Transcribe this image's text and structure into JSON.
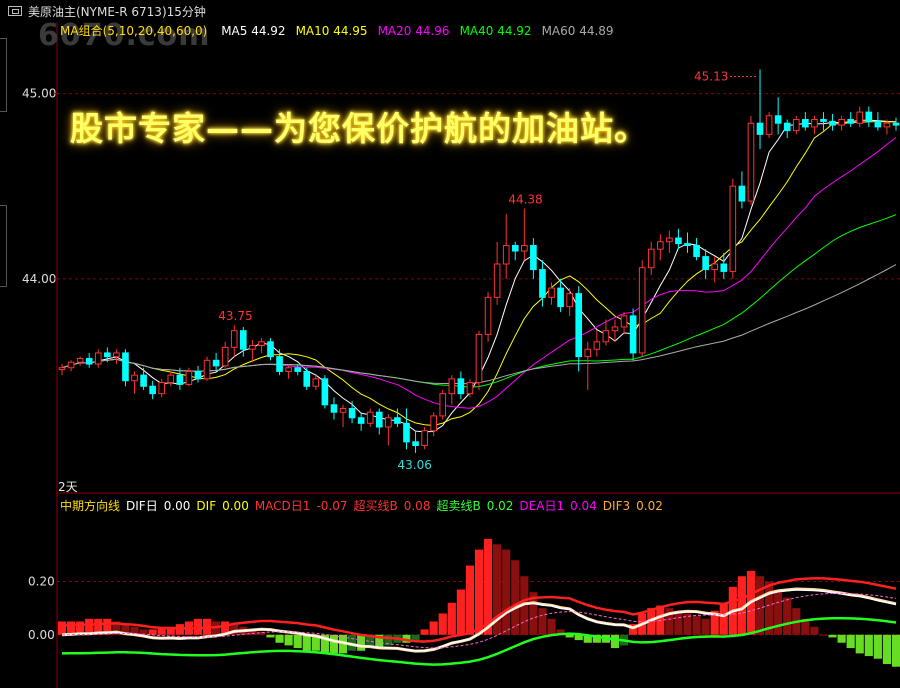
{
  "window": {
    "title": "美原油主(NYME-R 6713)15分钟",
    "watermark": "6070.com"
  },
  "slogan": "股市专家——为您保价护航的加油站。",
  "ma_bar": {
    "group_label": "MA组合(5,10,20,40,60,0)",
    "items": [
      {
        "label": "MA5 44.92",
        "color": "#ffffff"
      },
      {
        "label": "MA10 44.95",
        "color": "#ffff00"
      },
      {
        "label": "MA20 44.96",
        "color": "#ff00ff"
      },
      {
        "label": "MA40 44.92",
        "color": "#00ff00"
      },
      {
        "label": "MA60 44.89",
        "color": "#aaaaaa"
      }
    ]
  },
  "period_label": "2天",
  "macd_bar": {
    "items": [
      {
        "label": "中期方向线",
        "color": "#ffdd00"
      },
      {
        "label": "DIF日",
        "color": "#ffffff"
      },
      {
        "label": "0.00",
        "color": "#ffffff"
      },
      {
        "label": "DIF",
        "color": "#ffff00"
      },
      {
        "label": "0.00",
        "color": "#ffff00"
      },
      {
        "label": "MACD日1",
        "color": "#ff3333"
      },
      {
        "label": "-0.07",
        "color": "#ff3333"
      },
      {
        "label": "超买线B",
        "color": "#ff3333"
      },
      {
        "label": "0.08",
        "color": "#ff3333"
      },
      {
        "label": "超卖线B",
        "color": "#33ff33"
      },
      {
        "label": "0.02",
        "color": "#33ff33"
      },
      {
        "label": "DEA日1",
        "color": "#ff00ff"
      },
      {
        "label": "0.04",
        "color": "#ff00ff"
      },
      {
        "label": "DIF3",
        "color": "#ffaa33"
      },
      {
        "label": "0.02",
        "color": "#ffaa33"
      }
    ]
  },
  "chart_data": {
    "type": "candlestick",
    "price_axis": {
      "ticks": [
        "45.00",
        "44.00"
      ],
      "range": [
        42.86,
        45.3
      ]
    },
    "macd_axis": {
      "ticks": [
        "0.20",
        "0.00"
      ],
      "range": [
        -0.2,
        0.45
      ]
    },
    "annotations": [
      {
        "label": "45.13",
        "kind": "high"
      },
      {
        "label": "44.38",
        "kind": "local-high"
      },
      {
        "label": "43.75",
        "kind": "local-high"
      },
      {
        "label": "43.06",
        "kind": "low"
      }
    ],
    "colors": {
      "up": "#ff3232",
      "down": "#00ffff",
      "grid": "#8a0000",
      "axis": "#8a0000"
    },
    "candles": [
      [
        43.51,
        43.54,
        43.48,
        43.52
      ],
      [
        43.52,
        43.56,
        43.5,
        43.55
      ],
      [
        43.55,
        43.58,
        43.53,
        43.57
      ],
      [
        43.57,
        43.6,
        43.52,
        43.54
      ],
      [
        43.54,
        43.62,
        43.52,
        43.6
      ],
      [
        43.6,
        43.63,
        43.55,
        43.58
      ],
      [
        43.58,
        43.62,
        43.54,
        43.6
      ],
      [
        43.6,
        43.62,
        43.42,
        43.45
      ],
      [
        43.45,
        43.5,
        43.38,
        43.48
      ],
      [
        43.48,
        43.52,
        43.4,
        43.42
      ],
      [
        43.42,
        43.45,
        43.35,
        43.38
      ],
      [
        43.38,
        43.46,
        43.36,
        43.44
      ],
      [
        43.44,
        43.5,
        43.42,
        43.48
      ],
      [
        43.48,
        43.52,
        43.4,
        43.43
      ],
      [
        43.43,
        43.52,
        43.42,
        43.5
      ],
      [
        43.5,
        43.53,
        43.44,
        43.46
      ],
      [
        43.46,
        43.58,
        43.45,
        43.56
      ],
      [
        43.56,
        43.6,
        43.5,
        43.53
      ],
      [
        43.53,
        43.66,
        43.52,
        43.63
      ],
      [
        43.63,
        43.75,
        43.58,
        43.72
      ],
      [
        43.72,
        43.74,
        43.58,
        43.62
      ],
      [
        43.62,
        43.67,
        43.55,
        43.64
      ],
      [
        43.64,
        43.68,
        43.6,
        43.66
      ],
      [
        43.66,
        43.68,
        43.56,
        43.58
      ],
      [
        43.58,
        43.62,
        43.48,
        43.5
      ],
      [
        43.5,
        43.53,
        43.46,
        43.52
      ],
      [
        43.52,
        43.54,
        43.48,
        43.5
      ],
      [
        43.5,
        43.52,
        43.4,
        43.42
      ],
      [
        43.42,
        43.48,
        43.4,
        43.46
      ],
      [
        43.46,
        43.48,
        43.3,
        43.32
      ],
      [
        43.32,
        43.36,
        43.24,
        43.28
      ],
      [
        43.28,
        43.32,
        43.2,
        43.3
      ],
      [
        43.3,
        43.34,
        43.22,
        43.25
      ],
      [
        43.25,
        43.28,
        43.18,
        43.22
      ],
      [
        43.22,
        43.3,
        43.2,
        43.28
      ],
      [
        43.28,
        43.3,
        43.16,
        43.2
      ],
      [
        43.2,
        43.27,
        43.1,
        43.25
      ],
      [
        43.25,
        43.3,
        43.2,
        43.22
      ],
      [
        43.22,
        43.3,
        43.08,
        43.12
      ],
      [
        43.12,
        43.18,
        43.06,
        43.1
      ],
      [
        43.1,
        43.2,
        43.08,
        43.18
      ],
      [
        43.18,
        43.28,
        43.15,
        43.26
      ],
      [
        43.26,
        43.4,
        43.24,
        43.38
      ],
      [
        43.38,
        43.48,
        43.32,
        43.46
      ],
      [
        43.46,
        43.5,
        43.35,
        43.38
      ],
      [
        43.38,
        43.46,
        43.36,
        43.44
      ],
      [
        43.44,
        43.72,
        43.4,
        43.7
      ],
      [
        43.7,
        43.93,
        43.66,
        43.9
      ],
      [
        43.9,
        44.2,
        43.86,
        44.08
      ],
      [
        44.08,
        44.35,
        44.0,
        44.18
      ],
      [
        44.18,
        44.2,
        44.1,
        44.15
      ],
      [
        44.15,
        44.38,
        44.1,
        44.18
      ],
      [
        44.18,
        44.22,
        44.0,
        44.05
      ],
      [
        44.05,
        44.1,
        43.85,
        43.9
      ],
      [
        43.9,
        43.98,
        43.86,
        43.95
      ],
      [
        43.95,
        44.0,
        43.82,
        43.85
      ],
      [
        43.85,
        43.95,
        43.8,
        43.92
      ],
      [
        43.92,
        43.96,
        43.5,
        43.58
      ],
      [
        43.58,
        43.66,
        43.4,
        43.62
      ],
      [
        43.62,
        43.72,
        43.58,
        43.66
      ],
      [
        43.66,
        43.78,
        43.64,
        43.72
      ],
      [
        43.72,
        43.78,
        43.66,
        43.74
      ],
      [
        43.74,
        43.82,
        43.7,
        43.8
      ],
      [
        43.8,
        43.84,
        43.56,
        43.6
      ],
      [
        43.6,
        44.1,
        43.58,
        44.06
      ],
      [
        44.06,
        44.2,
        44.02,
        44.16
      ],
      [
        44.16,
        44.24,
        44.1,
        44.2
      ],
      [
        44.2,
        44.26,
        44.14,
        44.22
      ],
      [
        44.22,
        44.27,
        44.16,
        44.19
      ],
      [
        44.19,
        44.25,
        44.14,
        44.18
      ],
      [
        44.18,
        44.22,
        44.1,
        44.12
      ],
      [
        44.12,
        44.16,
        44.0,
        44.05
      ],
      [
        44.05,
        44.12,
        43.98,
        44.08
      ],
      [
        44.08,
        44.14,
        44.0,
        44.04
      ],
      [
        44.04,
        44.54,
        44.0,
        44.5
      ],
      [
        44.5,
        44.58,
        44.38,
        44.42
      ],
      [
        44.42,
        44.88,
        44.4,
        44.84
      ],
      [
        44.84,
        45.13,
        44.7,
        44.78
      ],
      [
        44.78,
        44.9,
        44.76,
        44.88
      ],
      [
        44.88,
        44.98,
        44.78,
        44.84
      ],
      [
        44.84,
        44.86,
        44.76,
        44.8
      ],
      [
        44.8,
        44.88,
        44.78,
        44.86
      ],
      [
        44.86,
        44.9,
        44.8,
        44.82
      ],
      [
        44.82,
        44.88,
        44.78,
        44.86
      ],
      [
        44.86,
        44.9,
        44.8,
        44.85
      ],
      [
        44.85,
        44.89,
        44.8,
        44.83
      ],
      [
        44.83,
        44.88,
        44.8,
        44.86
      ],
      [
        44.86,
        44.9,
        44.82,
        44.84
      ],
      [
        44.84,
        44.93,
        44.82,
        44.9
      ],
      [
        44.9,
        44.93,
        44.82,
        44.85
      ],
      [
        44.85,
        44.9,
        44.8,
        44.82
      ],
      [
        44.82,
        44.86,
        44.78,
        44.84
      ],
      [
        44.84,
        44.87,
        44.8,
        44.83
      ]
    ],
    "histogram": [
      0.05,
      0.05,
      0.05,
      0.06,
      0.06,
      0.06,
      0.05,
      0.04,
      0.03,
      0.02,
      0.02,
      0.03,
      0.03,
      0.04,
      0.05,
      0.06,
      0.06,
      0.05,
      0.05,
      0.04,
      0.03,
      0.02,
      0.01,
      -0.01,
      -0.03,
      -0.04,
      -0.05,
      -0.06,
      -0.06,
      -0.07,
      -0.07,
      -0.07,
      -0.06,
      -0.06,
      -0.05,
      -0.05,
      -0.04,
      -0.03,
      -0.03,
      -0.02,
      0.02,
      0.05,
      0.08,
      0.12,
      0.17,
      0.26,
      0.32,
      0.36,
      0.34,
      0.32,
      0.28,
      0.22,
      0.16,
      0.1,
      0.06,
      0.02,
      -0.01,
      -0.02,
      -0.03,
      -0.03,
      -0.03,
      -0.05,
      -0.04,
      0.04,
      0.08,
      0.1,
      0.11,
      0.1,
      0.09,
      0.08,
      0.07,
      0.06,
      0.09,
      0.12,
      0.18,
      0.22,
      0.24,
      0.22,
      0.2,
      0.17,
      0.14,
      0.1,
      0.06,
      0.03,
      0.0,
      -0.01,
      -0.03,
      -0.05,
      -0.07,
      -0.08,
      -0.09,
      -0.11,
      -0.12
    ],
    "ma_lines": [
      {
        "name": "MA5",
        "color": "#ffffff"
      },
      {
        "name": "MA10",
        "color": "#ffff00"
      },
      {
        "name": "MA20",
        "color": "#ff00ff"
      },
      {
        "name": "MA40",
        "color": "#00ff00"
      },
      {
        "name": "MA60",
        "color": "#aaaaaa"
      }
    ],
    "macd_lines": [
      {
        "name": "DIF日",
        "color": "#ffffff"
      },
      {
        "name": "DIF",
        "color": "#ffddaa"
      },
      {
        "name": "超买线B",
        "color": "#ff2020"
      },
      {
        "name": "超卖线B",
        "color": "#20ff20"
      },
      {
        "name": "DEA日1",
        "color": "#ff66cc"
      }
    ]
  }
}
